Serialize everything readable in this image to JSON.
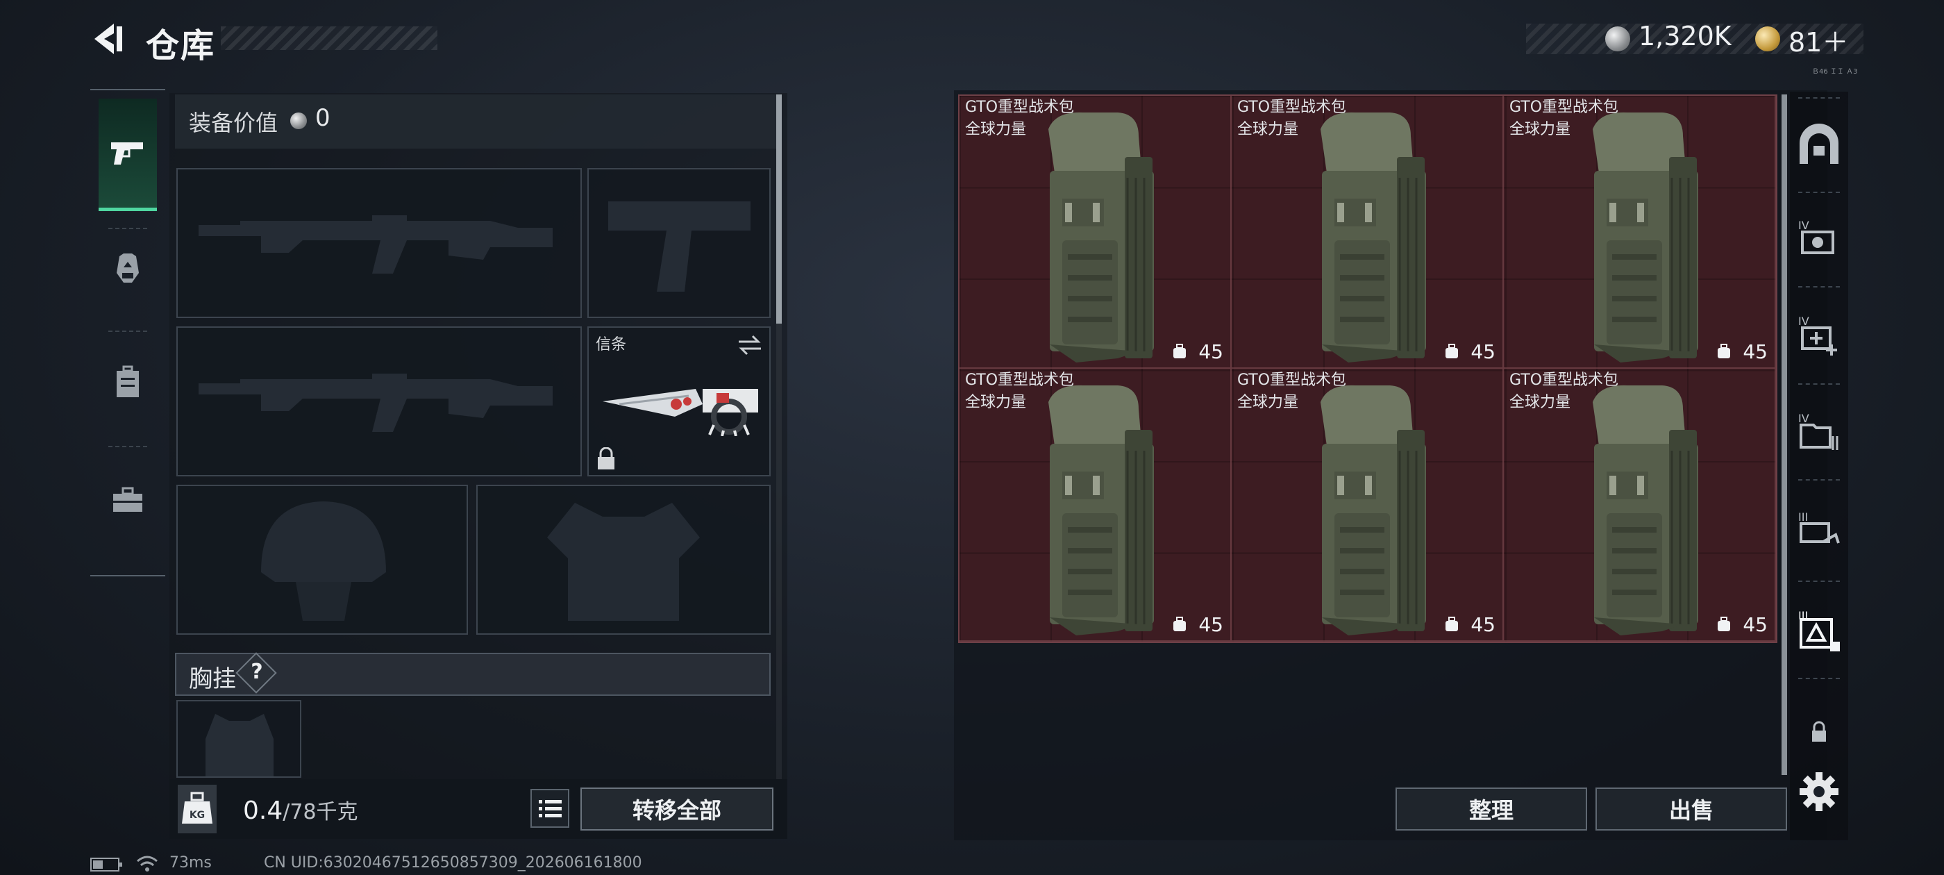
{
  "header": {
    "title": "仓库"
  },
  "currency": {
    "silver": "1,320K",
    "gold": "81＋",
    "tiny": "Ｂ46 ＩＩ Ａ3"
  },
  "nav": {
    "items": [
      "pistol-icon",
      "gas-mask-icon",
      "backpack-icon",
      "toolbox-icon"
    ],
    "active": 0
  },
  "equipment": {
    "value_label": "装备价值",
    "value": "0",
    "melee_label": "信条",
    "chest_label": "胸挂",
    "chest_help": "?"
  },
  "weight": {
    "current": "0.4",
    "max": "/78千克",
    "kg_label": "KG"
  },
  "buttons": {
    "transfer_all": "转移全部",
    "sort": "整理",
    "sell": "出售"
  },
  "store_items": [
    {
      "name": "GTO重型战术包",
      "brand": "全球力量",
      "count": "45"
    },
    {
      "name": "GTO重型战术包",
      "brand": "全球力量",
      "count": "45"
    },
    {
      "name": "GTO重型战术包",
      "brand": "全球力量",
      "count": "45"
    },
    {
      "name": "GTO重型战术包",
      "brand": "全球力量",
      "count": "45"
    },
    {
      "name": "GTO重型战术包",
      "brand": "全球力量",
      "count": "45"
    },
    {
      "name": "GTO重型战术包",
      "brand": "全球力量",
      "count": "45"
    }
  ],
  "right_nav": {
    "tier_labels": [
      "IV",
      "IV",
      "IV",
      "III",
      "III"
    ]
  },
  "status": {
    "ping": "73ms",
    "uid": "CN UID:63020467512650857309_202606161800"
  }
}
